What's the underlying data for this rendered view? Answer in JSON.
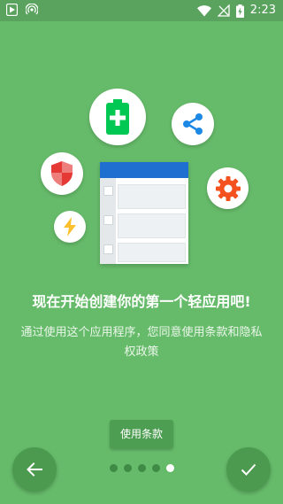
{
  "status_bar": {
    "time": "2:23"
  },
  "colors": {
    "background": "#66bb6a",
    "status_bar": "#5aa35e",
    "button": "#4c9a50",
    "accent_blue": "#1f6fd1",
    "battery_green": "#00c853",
    "shield_red": "#e53935",
    "share_blue": "#1e88e5",
    "gear_orange": "#f4511e",
    "bolt_yellow": "#fbc02d"
  },
  "illustration": {
    "icons": [
      "battery-plus-icon",
      "share-icon",
      "shield-icon",
      "gear-icon",
      "lightning-icon",
      "document-list-icon"
    ]
  },
  "content": {
    "title": "现在开始创建你的第一个轻应用吧!",
    "description": "通过使用这个应用程序，您同意使用条款和隐私权政策"
  },
  "buttons": {
    "terms_label": "使用条款"
  },
  "pager": {
    "total": 5,
    "current": 5
  }
}
